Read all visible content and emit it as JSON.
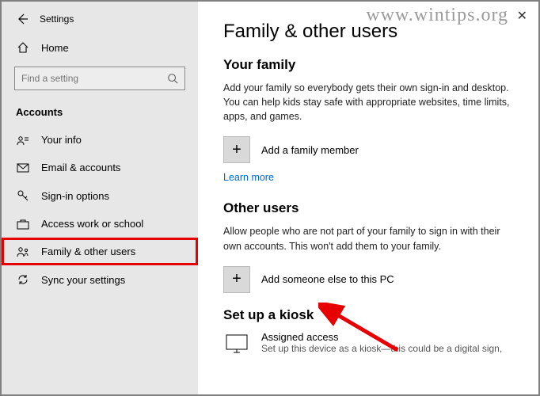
{
  "sidebar": {
    "title": "Settings",
    "home": "Home",
    "search_placeholder": "Find a setting",
    "section": "Accounts",
    "items": [
      {
        "label": "Your info"
      },
      {
        "label": "Email & accounts"
      },
      {
        "label": "Sign-in options"
      },
      {
        "label": "Access work or school"
      },
      {
        "label": "Family & other users"
      },
      {
        "label": "Sync your settings"
      }
    ]
  },
  "main": {
    "title": "Family & other users",
    "family_head": "Your family",
    "family_text": "Add your family so everybody gets their own sign-in and desktop. You can help kids stay safe with appropriate websites, time limits, apps, and games.",
    "add_family": "Add a family member",
    "learn_more": "Learn more",
    "other_head": "Other users",
    "other_text": "Allow people who are not part of your family to sign in with their own accounts. This won't add them to your family.",
    "add_other": "Add someone else to this PC",
    "kiosk_head": "Set up a kiosk",
    "kiosk_title": "Assigned access",
    "kiosk_sub": "Set up this device as a kiosk—this could be a digital sign,"
  },
  "watermark": "www.wintips.org"
}
